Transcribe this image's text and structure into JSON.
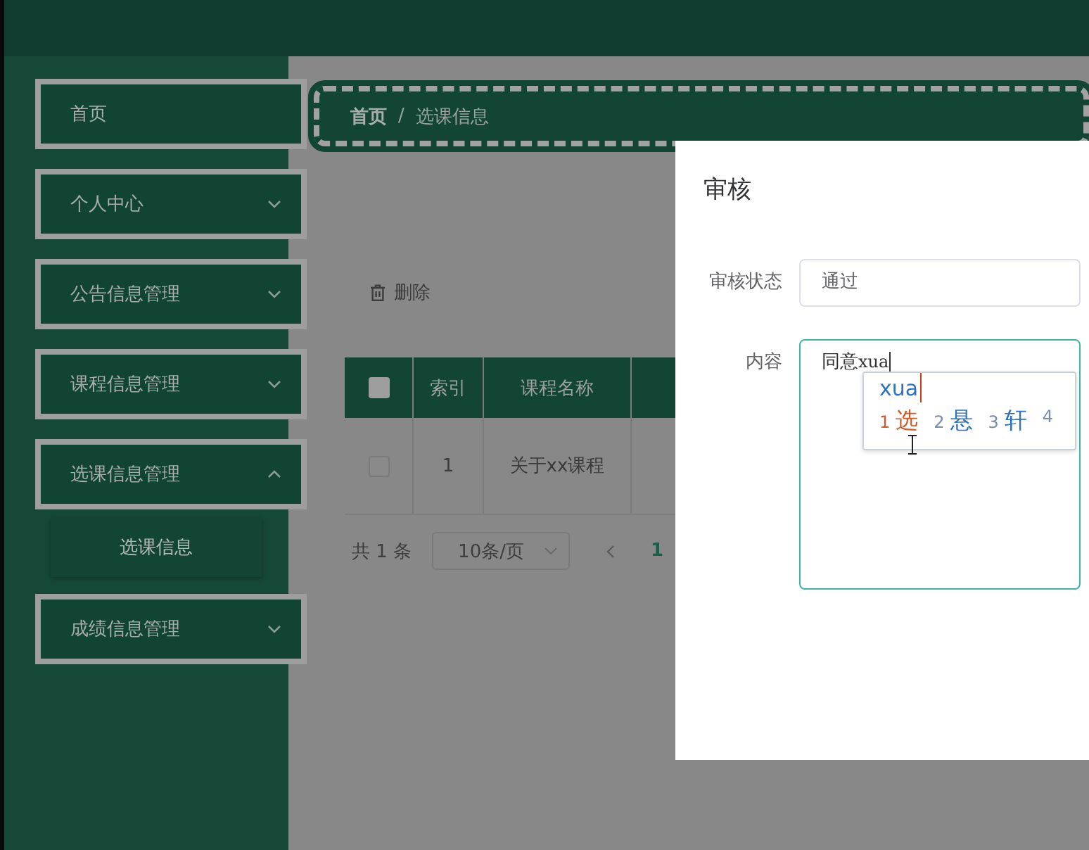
{
  "sidebar": {
    "items": [
      {
        "label": "首页",
        "kind": "link"
      },
      {
        "label": "个人中心",
        "kind": "group",
        "expanded": false
      },
      {
        "label": "公告信息管理",
        "kind": "group",
        "expanded": false
      },
      {
        "label": "课程信息管理",
        "kind": "group",
        "expanded": false
      },
      {
        "label": "选课信息管理",
        "kind": "group",
        "expanded": true,
        "children": [
          {
            "label": "选课信息",
            "selected": true
          }
        ]
      },
      {
        "label": "成绩信息管理",
        "kind": "group",
        "expanded": false
      }
    ]
  },
  "breadcrumb": {
    "items": [
      "首页",
      "选课信息"
    ],
    "separator": "/"
  },
  "toolbar": {
    "delete_button": "删除"
  },
  "table": {
    "header_checked": false,
    "columns": [
      "索引",
      "课程名称"
    ],
    "rows": [
      {
        "checked": false,
        "cells": [
          "1",
          "关于xx课程"
        ]
      }
    ]
  },
  "pagination": {
    "total": "共 1 条",
    "page_size": "10条/页",
    "pages": [
      {
        "label": "1",
        "selected": true
      }
    ]
  },
  "dialog": {
    "title": "审核",
    "fields": [
      {
        "kind": "select",
        "label": "审核状态",
        "value": "通过"
      },
      {
        "kind": "textarea",
        "label": "内容",
        "value": "同意",
        "composing": "xua"
      }
    ]
  },
  "ime": {
    "input": "xua",
    "candidates": [
      {
        "index": "1",
        "text": "选",
        "selected": true
      },
      {
        "index": "2",
        "text": "悬",
        "selected": false
      },
      {
        "index": "3",
        "text": "轩",
        "selected": false
      },
      {
        "index": "4",
        "selected": false
      }
    ]
  }
}
